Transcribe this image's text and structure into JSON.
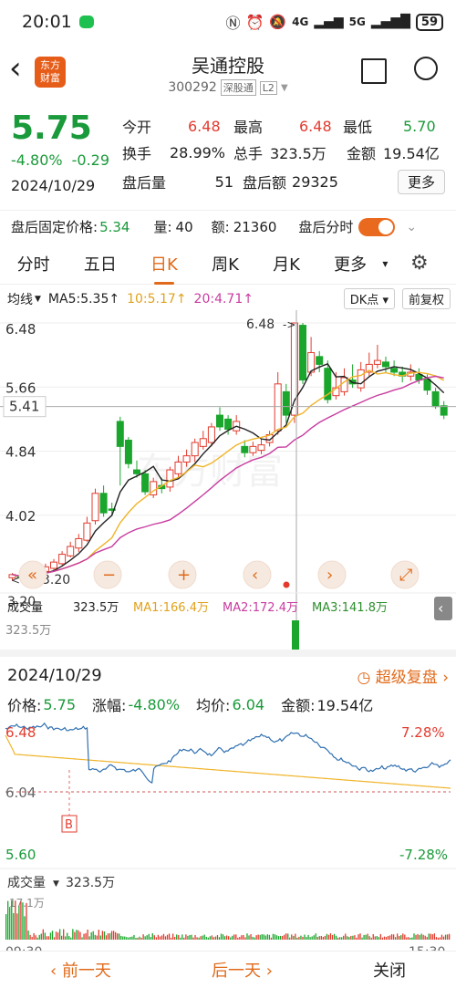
{
  "status": {
    "time": "20:01",
    "net_4g": "4G",
    "net_5g": "5G",
    "battery": "59"
  },
  "nav": {
    "logo_line1": "东方",
    "logo_line2": "财富",
    "stock_name": "吴通控股",
    "stock_code": "300292",
    "market_tag": "深股通",
    "level_tag": "L2"
  },
  "quote": {
    "price": "5.75",
    "change_pct": "-4.80%",
    "change_amt": "-0.29",
    "date": "2024/10/29",
    "stats": [
      {
        "label": "今开",
        "value": "6.48"
      },
      {
        "label": "最高",
        "value": "6.48"
      },
      {
        "label": "最低",
        "value": "5.70"
      },
      {
        "label": "换手",
        "value": "28.99%"
      },
      {
        "label": "总手",
        "value": "323.5万"
      },
      {
        "label": "金额",
        "value": "19.54亿"
      }
    ],
    "after_vol_label": "盘后量",
    "after_vol": "51",
    "after_amt_label": "盘后额",
    "after_amt": "29325",
    "more_label": "更多"
  },
  "after_hours": {
    "price_label": "盘后固定价格:",
    "price": "5.34",
    "vol_label": "量:",
    "vol": "40",
    "amt_label": "额:",
    "amt": "21360",
    "share_label": "盘后分时"
  },
  "tabs": [
    "分时",
    "五日",
    "日K",
    "周K",
    "月K",
    "更多"
  ],
  "active_tab": 2,
  "kline": {
    "ma_label": "均线",
    "ma5": "MA5:5.35",
    "ma10": "10:5.17",
    "ma20": "20:4.71",
    "dk_label": "DK点",
    "adjust_label": "前复权",
    "y_labels": [
      "6.48",
      "5.66",
      "4.84",
      "4.02",
      "3.20"
    ],
    "cursor_price": "5.41",
    "high_marker": "6.48",
    "low_marker": "3.20",
    "watermark": "东方财富",
    "vol_label": "成交量",
    "vol_value": "323.5万",
    "vma1": "MA1:166.4万",
    "vma2": "MA2:172.4万",
    "vma3": "MA3:141.8万",
    "vol_axis": "323.5万",
    "colors": {
      "up": "#e23b2e",
      "down": "#1aa62c",
      "ma5": "#222222",
      "ma10": "#f0b429",
      "ma20": "#c83ca0"
    }
  },
  "intraday": {
    "date": "2024/10/29",
    "super_review": "超级复盘",
    "price_label": "价格:",
    "price": "5.75",
    "change_label": "涨幅:",
    "change": "-4.80%",
    "avg_label": "均价:",
    "avg": "6.04",
    "amt_label": "金额:",
    "amt": "19.54亿",
    "top_left": "6.48",
    "top_right": "7.28%",
    "mid_left": "6.04",
    "bottom_left": "5.60",
    "bottom_right": "-7.28%",
    "b_marker": "B",
    "vol_label": "成交量",
    "vol_value": "323.5万",
    "vol_axis": "17.1万",
    "time_start": "09:30",
    "time_end": "15:30"
  },
  "bottom": {
    "prev": "前一天",
    "next": "后一天",
    "close": "关闭"
  }
}
